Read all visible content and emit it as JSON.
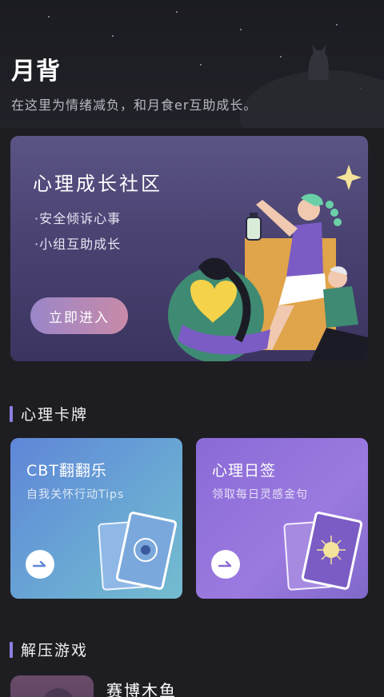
{
  "header": {
    "title": "月背",
    "subtitle": "在这里为情绪减负，和月食er互助成长。"
  },
  "community": {
    "title": "心理成长社区",
    "points": [
      "·安全倾诉心事",
      "·小组互助成长"
    ],
    "button_label": "立即进入"
  },
  "sections": {
    "cards_title": "心理卡牌",
    "games_title": "解压游戏"
  },
  "cards": [
    {
      "title": "CBT翻翻乐",
      "desc": "自我关怀行动Tips"
    },
    {
      "title": "心理日签",
      "desc": "领取每日灵感金句"
    }
  ],
  "games": [
    {
      "title": "赛博木鱼"
    }
  ],
  "colors": {
    "background": "#1e1e22",
    "accent": "#8b7fe0",
    "community_card": "#4a4372",
    "card_blue": "#6aa9d4",
    "card_purple": "#9b7ae0"
  }
}
